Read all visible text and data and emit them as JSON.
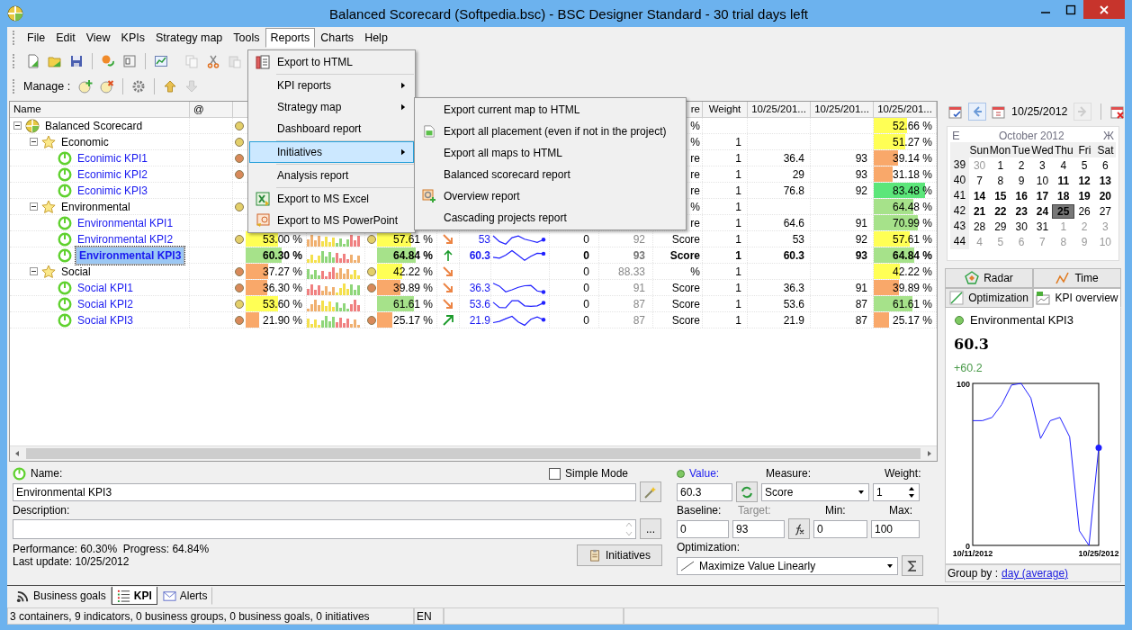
{
  "window": {
    "title": "Balanced Scorecard (Softpedia.bsc) - BSC Designer Standard - 30 trial days left"
  },
  "menu": [
    {
      "label": "File",
      "selected": false
    },
    {
      "label": "Edit",
      "selected": false
    },
    {
      "label": "View",
      "selected": false
    },
    {
      "label": "KPIs",
      "selected": false
    },
    {
      "label": "Strategy map",
      "selected": false
    },
    {
      "label": "Tools",
      "selected": false
    },
    {
      "label": "Reports",
      "selected": true
    },
    {
      "label": "Charts",
      "selected": false
    },
    {
      "label": "Help",
      "selected": false
    }
  ],
  "toolbar": {
    "label": "Manage :"
  },
  "reports_menu": [
    {
      "label": "Export to HTML",
      "submenu": false,
      "selected": false,
      "separator_after": true
    },
    {
      "label": "KPI reports",
      "submenu": true,
      "selected": false,
      "separator_after": false
    },
    {
      "label": "Strategy map",
      "submenu": true,
      "selected": false,
      "separator_after": false
    },
    {
      "label": "Dashboard report",
      "submenu": false,
      "selected": false,
      "separator_after": true
    },
    {
      "label": "Initiatives",
      "submenu": true,
      "selected": true,
      "separator_after": true
    },
    {
      "label": "Analysis report",
      "submenu": false,
      "selected": false,
      "separator_after": true
    },
    {
      "label": "Export to MS Excel",
      "submenu": false,
      "selected": false,
      "separator_after": false
    },
    {
      "label": "Export to MS PowerPoint",
      "submenu": false,
      "selected": false,
      "separator_after": false
    }
  ],
  "submenu": [
    {
      "label": "Export current map to HTML"
    },
    {
      "label": "Export all placement (even if not in the project)"
    },
    {
      "label": "Export all maps to HTML"
    },
    {
      "label": "Balanced scorecard report"
    },
    {
      "label": "Overview report"
    },
    {
      "label": "Cascading projects report"
    }
  ],
  "table": {
    "columns": [
      {
        "label": "Name"
      },
      {
        "label": "@"
      },
      {
        "label": "re"
      },
      {
        "label": "Weight"
      },
      {
        "label": "10/25/201..."
      },
      {
        "label": "10/25/201..."
      },
      {
        "label": "10/25/201..."
      }
    ],
    "rows": [
      {
        "name": "Balanced Scorecard",
        "kind": "scorecard",
        "expanded": true,
        "selected": false,
        "perf_dot": {
          "color": "#e3cf6a"
        },
        "measure": "%",
        "score": {
          "text": "52.66 %",
          "level": 0.53,
          "color": "#ffff55"
        },
        "children": [
          {
            "name": "Economic",
            "kind": "group",
            "expanded": true,
            "selected": false,
            "perf_dot": {
              "color": "#e3cf6a"
            },
            "measure": "%",
            "weight": "1",
            "score": {
              "text": "51.27 %",
              "level": 0.51,
              "color": "#ffff55"
            },
            "children": [
              {
                "name": "Econimic KPI1",
                "kind": "kpi",
                "selected": false,
                "perf_dot": {
                  "color": "#d8895a"
                },
                "measure": "re",
                "weight": "1",
                "date_col_1": "36.4",
                "date_col_2": "93",
                "score": {
                  "text": "39.14 %",
                  "level": 0.39,
                  "color": "#f9a86a"
                }
              },
              {
                "name": "Econimic KPI2",
                "kind": "kpi",
                "selected": false,
                "perf_dot": {
                  "color": "#d8895a"
                },
                "measure": "re",
                "weight": "1",
                "date_col_1": "29",
                "date_col_2": "93",
                "score": {
                  "text": "31.18 %",
                  "level": 0.31,
                  "color": "#f9a86a"
                }
              },
              {
                "name": "Econimic KPI3",
                "kind": "kpi",
                "selected": false,
                "measure": "re",
                "weight": "1",
                "date_col_1": "76.8",
                "date_col_2": "92",
                "score": {
                  "text": "83.48 %",
                  "level": 0.83,
                  "color": "#5ce67a"
                }
              }
            ]
          },
          {
            "name": "Environmental",
            "kind": "group",
            "expanded": true,
            "selected": false,
            "perf_dot": {
              "color": "#e3cf6a"
            },
            "measure": "%",
            "weight": "1",
            "score": {
              "text": "64.48 %",
              "level": 0.64,
              "color": "#a6e28a"
            },
            "children": [
              {
                "name": "Environmental KPI1",
                "kind": "kpi",
                "selected": false,
                "measure": "re",
                "weight": "1",
                "date_col_1": "64.6",
                "date_col_2": "91",
                "score": {
                  "text": "70.99 %",
                  "level": 0.71,
                  "color": "#a6e28a"
                }
              },
              {
                "name": "Environmental KPI2",
                "kind": "kpi",
                "selected": false,
                "perf_dot": {
                  "color": "#e3cf6a"
                },
                "perf": {
                  "text": "53.00 %",
                  "level": 0.53,
                  "color": "#ffff55"
                },
                "history": true,
                "progress_dot": {
                  "color": "#e3cf6a"
                },
                "progress": {
                  "text": "57.61 %",
                  "level": 0.58,
                  "color": "#ffff55"
                },
                "trend": {
                  "kind": "down"
                },
                "value": "53",
                "sparkline": true,
                "baseline": "0",
                "target": "92",
                "measure": "Score",
                "weight": "1",
                "date_col_1": "53",
                "date_col_2": "92",
                "score": {
                  "text": "57.61 %",
                  "level": 0.58,
                  "color": "#ffff55"
                }
              },
              {
                "name": "Environmental KPI3",
                "kind": "kpi",
                "selected": true,
                "perf": {
                  "text": "60.30 %",
                  "level": 0.6,
                  "color": "#a6e28a"
                },
                "history": true,
                "progress": {
                  "text": "64.84 %",
                  "level": 0.65,
                  "color": "#a6e28a"
                },
                "trend": {
                  "kind": "up"
                },
                "value": "60.3",
                "sparkline": true,
                "baseline": "0",
                "target": "93",
                "measure": "Score",
                "weight": "1",
                "date_col_1": "60.3",
                "date_col_2": "93",
                "score": {
                  "text": "64.84 %",
                  "level": 0.65,
                  "color": "#a6e28a"
                }
              }
            ]
          },
          {
            "name": "Social",
            "kind": "group",
            "expanded": true,
            "selected": false,
            "perf_dot": {
              "color": "#d8895a"
            },
            "perf": {
              "text": "37.27 %",
              "level": 0.37,
              "color": "#f9a86a"
            },
            "history": true,
            "progress_dot": {
              "color": "#e3cf6a"
            },
            "progress": {
              "text": "42.22 %",
              "level": 0.42,
              "color": "#ffff55"
            },
            "trend": {
              "kind": "down"
            },
            "baseline": "0",
            "target": "88.33",
            "measure": "%",
            "weight": "1",
            "score": {
              "text": "42.22 %",
              "level": 0.42,
              "color": "#ffff55"
            },
            "children": [
              {
                "name": "Social KPI1",
                "kind": "kpi",
                "selected": false,
                "perf_dot": {
                  "color": "#d8895a"
                },
                "perf": {
                  "text": "36.30 %",
                  "level": 0.36,
                  "color": "#f9a86a"
                },
                "history": true,
                "progress_dot": {
                  "color": "#d8895a"
                },
                "progress": {
                  "text": "39.89 %",
                  "level": 0.4,
                  "color": "#f9a86a"
                },
                "trend": {
                  "kind": "down"
                },
                "value": "36.3",
                "sparkline": true,
                "baseline": "0",
                "target": "91",
                "measure": "Score",
                "weight": "1",
                "date_col_1": "36.3",
                "date_col_2": "91",
                "score": {
                  "text": "39.89 %",
                  "level": 0.4,
                  "color": "#f9a86a"
                }
              },
              {
                "name": "Social KPI2",
                "kind": "kpi",
                "selected": false,
                "perf_dot": {
                  "color": "#e3cf6a"
                },
                "perf": {
                  "text": "53.60 %",
                  "level": 0.54,
                  "color": "#ffff55"
                },
                "history": true,
                "progress": {
                  "text": "61.61 %",
                  "level": 0.62,
                  "color": "#a6e28a"
                },
                "trend": {
                  "kind": "down"
                },
                "value": "53.6",
                "sparkline": true,
                "baseline": "0",
                "target": "87",
                "measure": "Score",
                "weight": "1",
                "date_col_1": "53.6",
                "date_col_2": "87",
                "score": {
                  "text": "61.61 %",
                  "level": 0.62,
                  "color": "#a6e28a"
                }
              },
              {
                "name": "Social KPI3",
                "kind": "kpi",
                "selected": false,
                "perf_dot": {
                  "color": "#d8895a"
                },
                "perf": {
                  "text": "21.90 %",
                  "level": 0.22,
                  "color": "#f9a86a"
                },
                "history": true,
                "progress_dot": {
                  "color": "#d8895a"
                },
                "progress": {
                  "text": "25.17 %",
                  "level": 0.25,
                  "color": "#f9a86a"
                },
                "trend": {
                  "kind": "up-right"
                },
                "value": "21.9",
                "sparkline": true,
                "baseline": "0",
                "target": "87",
                "measure": "Score",
                "weight": "1",
                "date_col_1": "21.9",
                "date_col_2": "87",
                "score": {
                  "text": "25.17 %",
                  "level": 0.25,
                  "color": "#f9a86a"
                }
              }
            ]
          }
        ]
      }
    ]
  },
  "calendar": {
    "date": "10/25/2012",
    "prev": "Е",
    "next": "Ж",
    "month": "October 2012",
    "weekdays": [
      "Sun",
      "Mon",
      "Tue",
      "Wed",
      "Thu",
      "Fri",
      "Sat"
    ],
    "weeks": [
      {
        "week": "39",
        "days": [
          {
            "d": "30",
            "muted": true,
            "bold": false,
            "selected": false
          },
          {
            "d": "1",
            "muted": false,
            "bold": false,
            "selected": false
          },
          {
            "d": "2",
            "muted": false,
            "bold": false,
            "selected": false
          },
          {
            "d": "3",
            "muted": false,
            "bold": false,
            "selected": false
          },
          {
            "d": "4",
            "muted": false,
            "bold": false,
            "selected": false
          },
          {
            "d": "5",
            "muted": false,
            "bold": false,
            "selected": false
          },
          {
            "d": "6",
            "muted": false,
            "bold": false,
            "selected": false
          }
        ]
      },
      {
        "week": "40",
        "days": [
          {
            "d": "7",
            "muted": false,
            "bold": false,
            "selected": false
          },
          {
            "d": "8",
            "muted": false,
            "bold": false,
            "selected": false
          },
          {
            "d": "9",
            "muted": false,
            "bold": false,
            "selected": false
          },
          {
            "d": "10",
            "muted": false,
            "bold": false,
            "selected": false
          },
          {
            "d": "11",
            "muted": false,
            "bold": true,
            "selected": false
          },
          {
            "d": "12",
            "muted": false,
            "bold": true,
            "selected": false
          },
          {
            "d": "13",
            "muted": false,
            "bold": true,
            "selected": false
          }
        ]
      },
      {
        "week": "41",
        "days": [
          {
            "d": "14",
            "muted": false,
            "bold": true,
            "selected": false
          },
          {
            "d": "15",
            "muted": false,
            "bold": true,
            "selected": false
          },
          {
            "d": "16",
            "muted": false,
            "bold": true,
            "selected": false
          },
          {
            "d": "17",
            "muted": false,
            "bold": true,
            "selected": false
          },
          {
            "d": "18",
            "muted": false,
            "bold": true,
            "selected": false
          },
          {
            "d": "19",
            "muted": false,
            "bold": true,
            "selected": false
          },
          {
            "d": "20",
            "muted": false,
            "bold": true,
            "selected": false
          }
        ]
      },
      {
        "week": "42",
        "days": [
          {
            "d": "21",
            "muted": false,
            "bold": true,
            "selected": false
          },
          {
            "d": "22",
            "muted": false,
            "bold": true,
            "selected": false
          },
          {
            "d": "23",
            "muted": false,
            "bold": true,
            "selected": false
          },
          {
            "d": "24",
            "muted": false,
            "bold": true,
            "selected": false
          },
          {
            "d": "25",
            "muted": false,
            "bold": true,
            "selected": true
          },
          {
            "d": "26",
            "muted": false,
            "bold": false,
            "selected": false
          },
          {
            "d": "27",
            "muted": false,
            "bold": false,
            "selected": false
          }
        ]
      },
      {
        "week": "43",
        "days": [
          {
            "d": "28",
            "muted": false,
            "bold": false,
            "selected": false
          },
          {
            "d": "29",
            "muted": false,
            "bold": false,
            "selected": false
          },
          {
            "d": "30",
            "muted": false,
            "bold": false,
            "selected": false
          },
          {
            "d": "31",
            "muted": false,
            "bold": false,
            "selected": false
          },
          {
            "d": "1",
            "muted": true,
            "bold": false,
            "selected": false
          },
          {
            "d": "2",
            "muted": true,
            "bold": false,
            "selected": false
          },
          {
            "d": "3",
            "muted": true,
            "bold": false,
            "selected": false
          }
        ]
      },
      {
        "week": "44",
        "days": [
          {
            "d": "4",
            "muted": true,
            "bold": false,
            "selected": false
          },
          {
            "d": "5",
            "muted": true,
            "bold": false,
            "selected": false
          },
          {
            "d": "6",
            "muted": true,
            "bold": false,
            "selected": false
          },
          {
            "d": "7",
            "muted": true,
            "bold": false,
            "selected": false
          },
          {
            "d": "8",
            "muted": true,
            "bold": false,
            "selected": false
          },
          {
            "d": "9",
            "muted": true,
            "bold": false,
            "selected": false
          },
          {
            "d": "10",
            "muted": true,
            "bold": false,
            "selected": false
          }
        ]
      }
    ]
  },
  "chart_tabs": [
    {
      "label": "Radar",
      "selected": false
    },
    {
      "label": "Time",
      "selected": false
    },
    {
      "label": "Optimization",
      "selected": false
    },
    {
      "label": "KPI overview",
      "selected": true
    }
  ],
  "overview": {
    "color": "#7ec862",
    "name": "Environmental KPI3",
    "value": "60.3",
    "change": "+60.2",
    "chart_data": {
      "type": "line",
      "categories": [
        "10/11/2012",
        null,
        null,
        null,
        null,
        null,
        null,
        null,
        null,
        null,
        null,
        null,
        null,
        "10/25/2012"
      ],
      "ylim": [
        0,
        100
      ],
      "yticks": [
        0,
        100
      ],
      "series": [
        {
          "color": "#2020ff",
          "values": [
            77,
            77,
            79,
            87,
            99,
            100,
            91,
            66,
            77,
            79,
            67,
            9,
            0,
            60.3
          ]
        }
      ]
    }
  },
  "group_by": {
    "label": "Group by :",
    "link": "day (average)"
  },
  "form": {
    "name_label": "Name:",
    "name": "Environmental KPI3",
    "simple_mode": {
      "label": "Simple Mode",
      "checked": false
    },
    "description_label": "Description:",
    "more_button": "...",
    "performance": "Performance: 60.30%  Progress: 64.84%",
    "last_update": "Last update: 10/25/2012",
    "initiatives": "Initiatives",
    "value_label": "Value:",
    "value": "60.3",
    "measure_label": "Measure:",
    "measure": "Score",
    "weight_label": "Weight:",
    "weight": "1",
    "baseline_label": "Baseline:",
    "baseline": "0",
    "target_label": "Target:",
    "target_disabled": true,
    "target": "93",
    "min_label": "Min:",
    "min": "0",
    "max_label": "Max:",
    "max": "100",
    "optimization_label": "Optimization:",
    "optimization": "Maximize Value Linearly"
  },
  "bottom_tabs": [
    {
      "label": "Business goals",
      "selected": false
    },
    {
      "label": "KPI",
      "selected": true
    },
    {
      "label": "Alerts",
      "selected": false
    }
  ],
  "status_bar": [
    "3 containers, 9 indicators, 0 business groups, 0 business goals, 0 initiatives",
    "EN"
  ]
}
